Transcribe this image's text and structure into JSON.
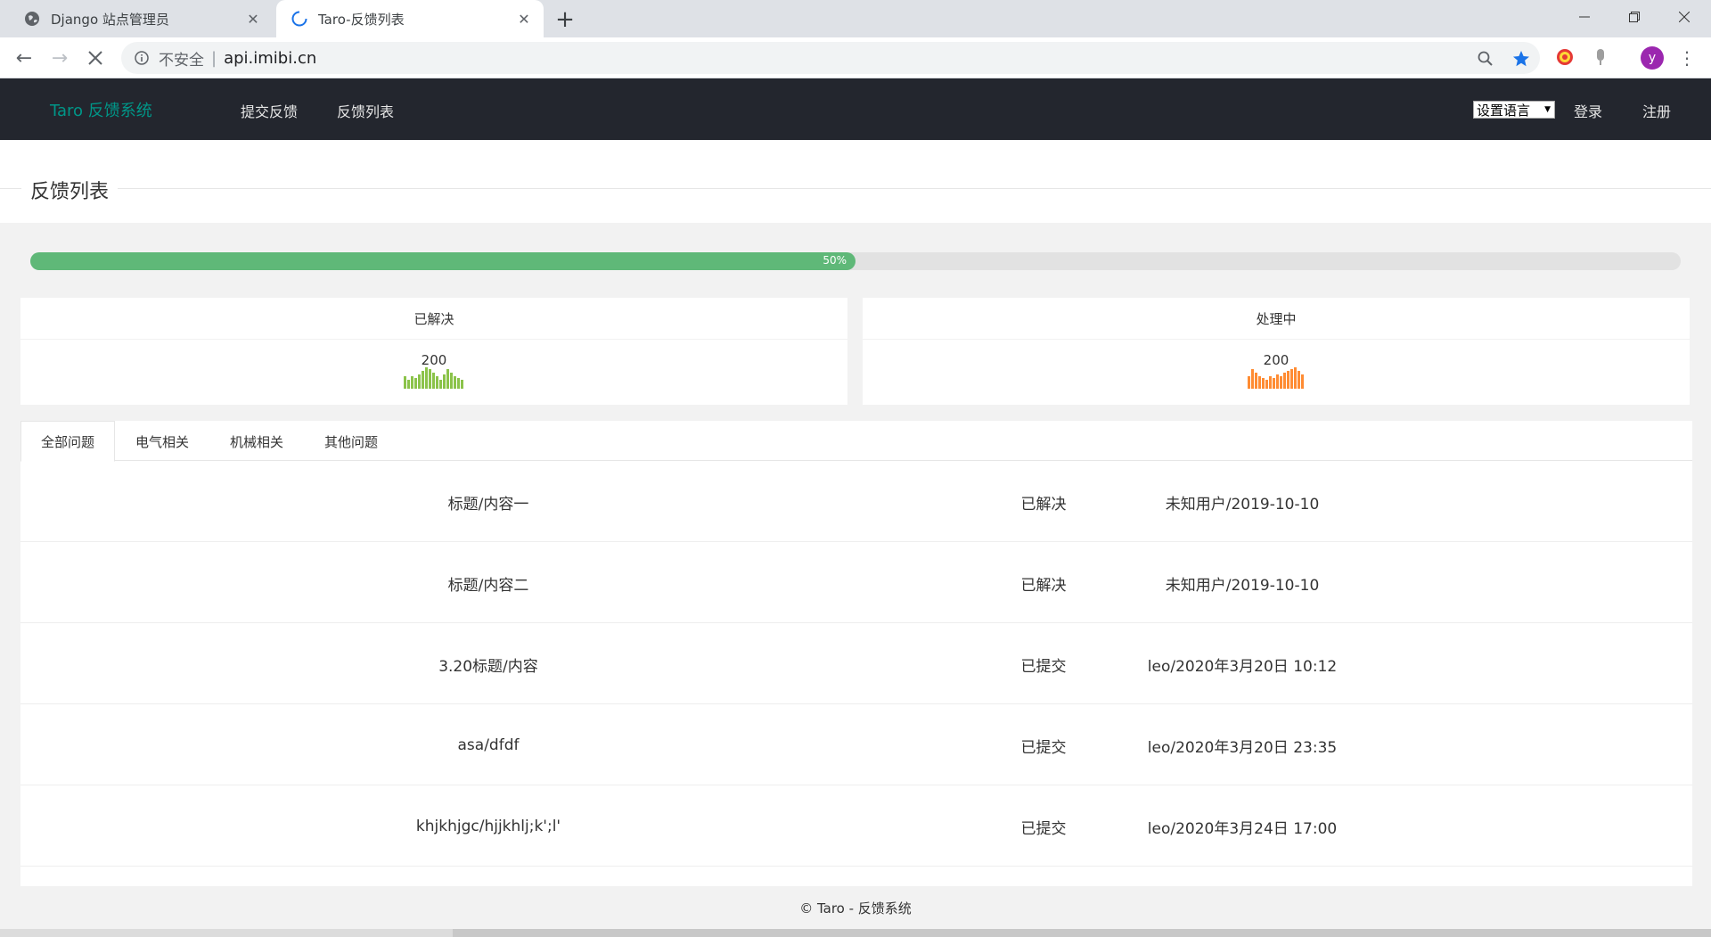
{
  "browser": {
    "tabs": [
      {
        "title": "Django 站点管理员",
        "active": false
      },
      {
        "title": "Taro-反馈列表",
        "active": true
      }
    ],
    "insecure_label": "不安全",
    "url": "api.imibi.cn",
    "profile_initial": "y"
  },
  "header": {
    "brand": "Taro 反馈系统",
    "nav": [
      "提交反馈",
      "反馈列表"
    ],
    "language_select": "设置语言",
    "login": "登录",
    "register": "注册"
  },
  "page": {
    "title": "反馈列表",
    "progress": {
      "value": 50,
      "label": "50%"
    }
  },
  "stats": [
    {
      "label": "已解决",
      "value": "200",
      "color": "#8bc34a",
      "bars": [
        14,
        10,
        14,
        12,
        16,
        20,
        24,
        22,
        18,
        14,
        10,
        16,
        22,
        18,
        14,
        12,
        10
      ]
    },
    {
      "label": "处理中",
      "value": "200",
      "color": "#ff8c33",
      "bars": [
        14,
        22,
        18,
        14,
        12,
        10,
        14,
        12,
        16,
        14,
        18,
        20,
        22,
        24,
        20,
        16
      ]
    }
  ],
  "categories": {
    "tabs": [
      "全部问题",
      "电气相关",
      "机械相关",
      "其他问题"
    ],
    "active": 0
  },
  "feedback": [
    {
      "title": "标题/内容一",
      "status": "已解决",
      "meta": "未知用户/2019-10-10"
    },
    {
      "title": "标题/内容二",
      "status": "已解决",
      "meta": "未知用户/2019-10-10"
    },
    {
      "title": "3.20标题/内容",
      "status": "已提交",
      "meta": "leo/2020年3月20日 10:12"
    },
    {
      "title": "asa/dfdf",
      "status": "已提交",
      "meta": "leo/2020年3月20日 23:35"
    },
    {
      "title": "khjkhjgc/hjjkhlj;k';l'",
      "status": "已提交",
      "meta": "leo/2020年3月24日 17:00"
    }
  ],
  "footer": "© Taro - 反馈系统",
  "colors": {
    "accent": "#009688",
    "progress": "#5fb878",
    "header_bg": "#23262e"
  }
}
